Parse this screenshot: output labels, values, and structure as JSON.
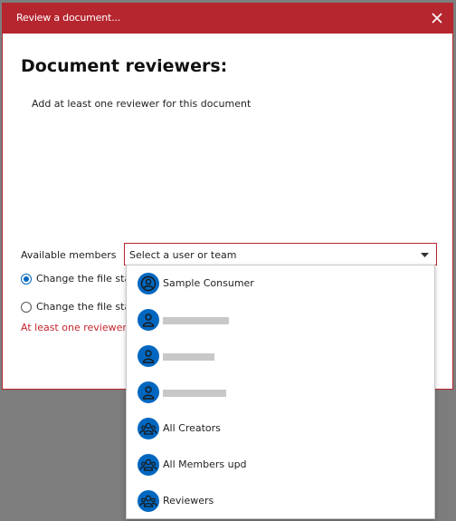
{
  "dialog": {
    "title": "Review a document...",
    "heading": "Document reviewers:",
    "instruction": "Add at least one reviewer for this document",
    "members_label": "Available members",
    "select_placeholder": "Select a user or team",
    "radio_options": [
      {
        "label": "Change the file status",
        "checked": true
      },
      {
        "label": "Change the file status",
        "checked": false
      }
    ],
    "error_text": "At least one reviewer is"
  },
  "dropdown": {
    "items": [
      {
        "label": "Sample Consumer",
        "icon": "user-circle-icon",
        "redacted": false
      },
      {
        "label": "",
        "icon": "user-icon",
        "redacted": true
      },
      {
        "label": "",
        "icon": "user-icon",
        "redacted": true
      },
      {
        "label": "",
        "icon": "user-icon",
        "redacted": true
      },
      {
        "label": "All Creators",
        "icon": "team-icon",
        "redacted": false
      },
      {
        "label": "All Members upd",
        "icon": "team-icon",
        "redacted": false
      },
      {
        "label": "Reviewers",
        "icon": "team-icon",
        "redacted": false
      }
    ]
  },
  "colors": {
    "accent": "#b5262f",
    "icon_blue": "#0067c0",
    "error": "#c4262e"
  }
}
